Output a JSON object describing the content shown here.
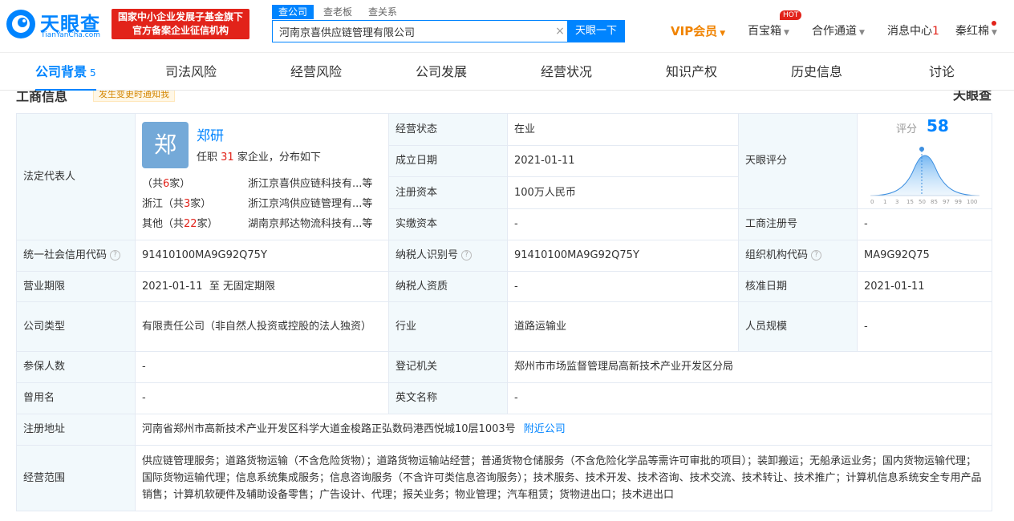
{
  "header": {
    "logo_text": "天眼查",
    "logo_sub": "TianYanCha.com",
    "gov_badge_line1": "国家中小企业发展子基金旗下",
    "gov_badge_line2": "官方备案企业征信机构",
    "search_tabs": [
      "查公司",
      "查老板",
      "查关系"
    ],
    "search_value": "河南京喜供应链管理有限公司",
    "search_button": "天眼一下",
    "vip": "VIP会员",
    "baibaoxiang": "百宝箱",
    "hot": "HOT",
    "hezuo": "合作通道",
    "messages": "消息中心",
    "message_count": "1",
    "user": "秦红棉"
  },
  "tabs": [
    {
      "label": "公司背景",
      "count": "5"
    },
    {
      "label": "司法风险"
    },
    {
      "label": "经营风险"
    },
    {
      "label": "公司发展"
    },
    {
      "label": "经营状况"
    },
    {
      "label": "知识产权"
    },
    {
      "label": "历史信息"
    },
    {
      "label": "讨论"
    }
  ],
  "section": {
    "title": "工商信息",
    "notify": "发生变更时通知我",
    "watermark": "天眼查"
  },
  "legal_rep": {
    "label": "法定代表人",
    "avatar": "郑",
    "name": "郑研",
    "sub_prefix": "任职",
    "sub_count": "31",
    "sub_suffix": "家企业，分布如下",
    "rows": [
      {
        "region_prefix": "（共",
        "count": "6",
        "region_suffix": "家）",
        "company": "浙江京喜供应链科技有...等"
      },
      {
        "region_prefix": "浙江（共",
        "count": "3",
        "region_suffix": "家）",
        "company": "浙江京鸿供应链管理有...等"
      },
      {
        "region_prefix": "其他（共",
        "count": "22",
        "region_suffix": "家）",
        "company": "湖南京邦达物流科技有...等"
      }
    ]
  },
  "score": {
    "label": "天眼评分",
    "title": "评分",
    "value": "58",
    "axis": [
      "0",
      "1",
      "3",
      "15",
      "50",
      "85",
      "97",
      "99",
      "100"
    ]
  },
  "fields": {
    "status_label": "经营状态",
    "status": "在业",
    "founded_label": "成立日期",
    "founded": "2021-01-11",
    "reg_capital_label": "注册资本",
    "reg_capital": "100万人民币",
    "paid_capital_label": "实缴资本",
    "paid_capital": "-",
    "biz_reg_no_label": "工商注册号",
    "biz_reg_no": "-",
    "credit_code_label": "统一社会信用代码",
    "credit_code": "91410100MA9G92Q75Y",
    "taxpayer_id_label": "纳税人识别号",
    "taxpayer_id": "91410100MA9G92Q75Y",
    "org_code_label": "组织机构代码",
    "org_code": "MA9G92Q75",
    "term_label": "营业期限",
    "term": "2021-01-11  至 无固定期限",
    "taxpayer_qual_label": "纳税人资质",
    "taxpayer_qual": "-",
    "approval_label": "核准日期",
    "approval": "2021-01-11",
    "type_label": "公司类型",
    "type": "有限责任公司（非自然人投资或控股的法人独资）",
    "industry_label": "行业",
    "industry": "道路运输业",
    "staff_label": "人员规模",
    "staff": "-",
    "insured_label": "参保人数",
    "insured": "-",
    "authority_label": "登记机关",
    "authority": "郑州市市场监督管理局高新技术产业开发区分局",
    "former_name_label": "曾用名",
    "former_name": "-",
    "english_label": "英文名称",
    "english": "-",
    "address_label": "注册地址",
    "address": "河南省郑州市高新技术产业开发区科学大道金梭路正弘数码港西悦城10层1003号",
    "nearby": "附近公司",
    "scope_label": "经营范围",
    "scope": "供应链管理服务；道路货物运输（不含危险货物）；道路货物运输站经营；普通货物仓储服务（不含危险化学品等需许可审批的项目）；装卸搬运；无船承运业务；国内货物运输代理；国际货物运输代理；信息系统集成服务；信息咨询服务（不含许可类信息咨询服务）；技术服务、技术开发、技术咨询、技术交流、技术转让、技术推广；计算机信息系统安全专用产品销售；计算机软硬件及辅助设备零售；广告设计、代理；报关业务；物业管理；汽车租赁；货物进出口；技术进出口"
  },
  "colors": {
    "brand": "#0084ff",
    "red": "#e2231a",
    "vip": "#f08300",
    "label_bg": "#f2f9fc"
  }
}
